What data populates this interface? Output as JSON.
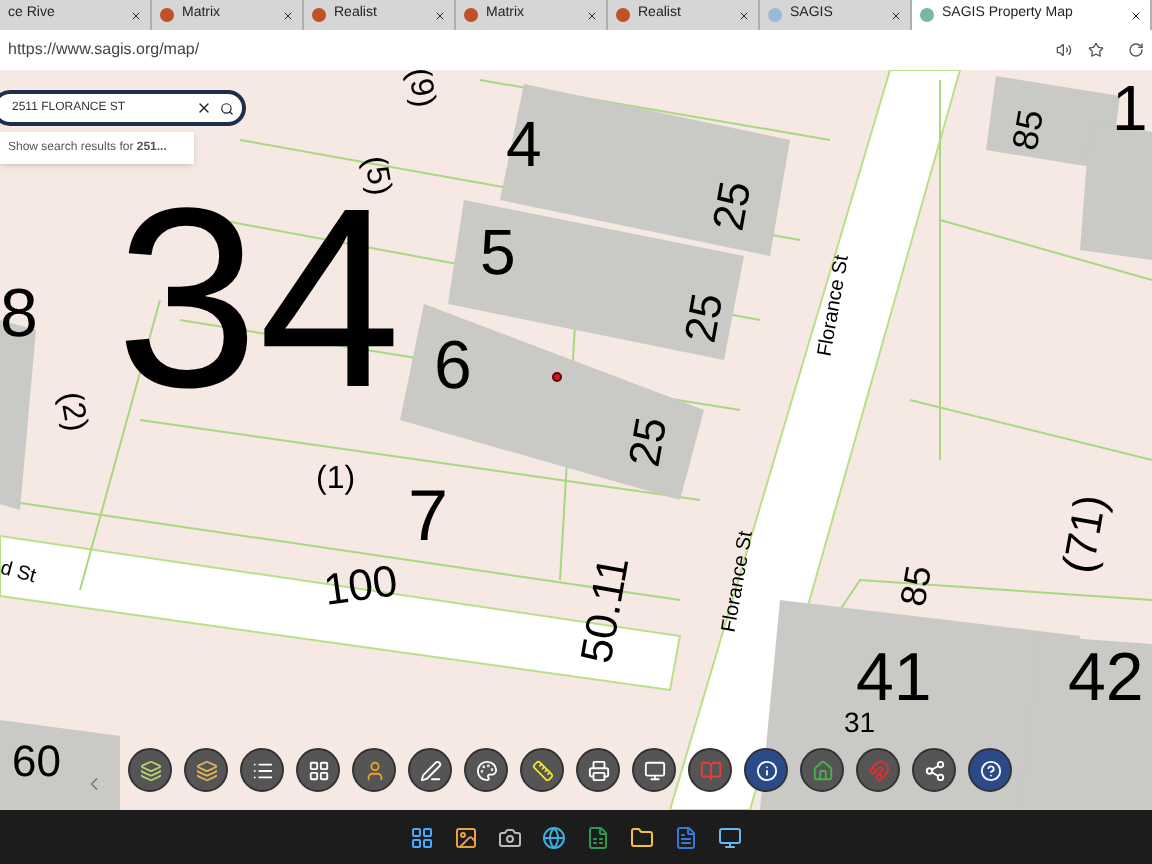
{
  "browser": {
    "tabs": [
      {
        "label": "ce Rive",
        "selected": false
      },
      {
        "label": "Matrix",
        "selected": false
      },
      {
        "label": "Realist",
        "selected": false
      },
      {
        "label": "Matrix",
        "selected": false
      },
      {
        "label": "Realist",
        "selected": false
      },
      {
        "label": "SAGIS",
        "selected": false
      },
      {
        "label": "SAGIS Property Map",
        "selected": true
      }
    ],
    "address": "https://www.sagis.org/map/"
  },
  "search": {
    "value": "2511 FLORANCE ST",
    "suggestion": "Show search results for **251...**"
  },
  "map_labels": [
    "(9)",
    "1",
    "4",
    "85",
    "(5)",
    "34",
    "25",
    "5",
    "8",
    "25",
    "Florance St",
    "6",
    "(2)",
    "25",
    "(1)",
    "7",
    "(71)",
    "d St",
    "100",
    "85",
    "Florance St",
    "50.11",
    "41",
    "42",
    "31",
    "60"
  ],
  "selected_marker": true
}
